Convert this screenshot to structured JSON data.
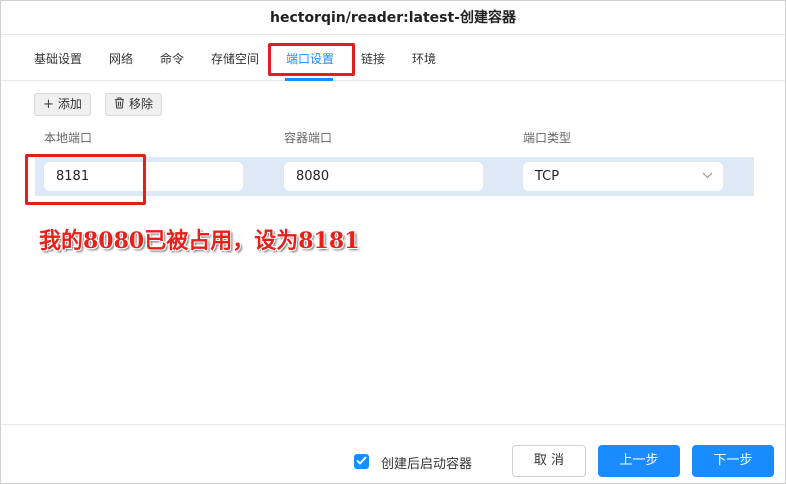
{
  "window": {
    "title": "hectorqin/reader:latest-创建容器"
  },
  "tabs": [
    {
      "label": "基础设置",
      "active": false
    },
    {
      "label": "网络",
      "active": false
    },
    {
      "label": "命令",
      "active": false
    },
    {
      "label": "存储空间",
      "active": false
    },
    {
      "label": "端口设置",
      "active": true
    },
    {
      "label": "链接",
      "active": false
    },
    {
      "label": "环境",
      "active": false
    }
  ],
  "toolbar": {
    "add_label": "添加",
    "add_icon": "plus-icon",
    "remove_label": "移除",
    "remove_icon": "trash-icon"
  },
  "ports": {
    "headers": {
      "local": "本地端口",
      "container": "容器端口",
      "type": "端口类型"
    },
    "rows": [
      {
        "local": "8181",
        "container": "8080",
        "type": "TCP"
      }
    ]
  },
  "annotation": {
    "text": "我的8080已被占用，设为8181",
    "color": "#e8201a"
  },
  "footer": {
    "autostart_label": "创建后启动容器",
    "autostart_checked": true,
    "cancel_label": "取 消",
    "prev_label": "上一步",
    "next_label": "下一步"
  },
  "colors": {
    "accent": "#1a8cff",
    "highlight": "#e02020",
    "row_selected": "#dde9f7"
  }
}
